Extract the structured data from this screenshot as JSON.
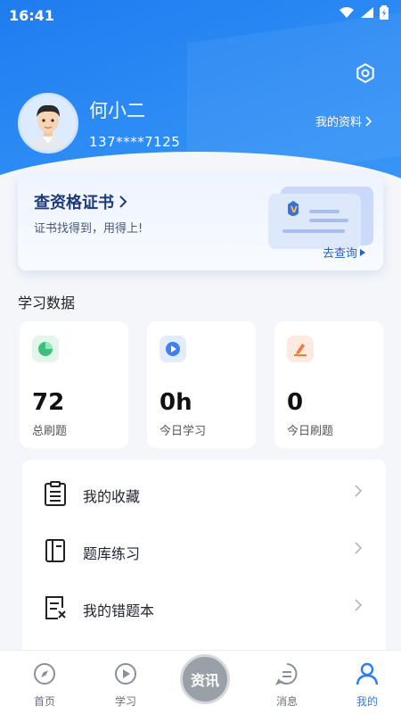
{
  "status_bar": {
    "time": "16:41"
  },
  "profile": {
    "name": "何小二",
    "phone": "137****7125",
    "profile_link": "我的资料"
  },
  "certificate": {
    "title": "查资格证书",
    "subtitle": "证书找得到，用得上!",
    "query_label": "去查询"
  },
  "stats": {
    "section_title": "学习数据",
    "items": [
      {
        "value": "72",
        "label": "总刷题",
        "icon": "pie-chart-icon",
        "color": "#3cc07a"
      },
      {
        "value": "0h",
        "label": "今日学习",
        "icon": "play-circle-icon",
        "color": "#3f7ff0"
      },
      {
        "value": "0",
        "label": "今日刷题",
        "icon": "edit-icon",
        "color": "#f07a3a"
      }
    ]
  },
  "menu": {
    "items": [
      {
        "label": "我的收藏",
        "icon": "clipboard-list-icon"
      },
      {
        "label": "题库练习",
        "icon": "notebook-icon"
      },
      {
        "label": "我的错题本",
        "icon": "wrong-note-icon"
      }
    ]
  },
  "tabbar": {
    "items": [
      {
        "label": "首页",
        "icon": "compass-icon"
      },
      {
        "label": "学习",
        "icon": "play-icon"
      },
      {
        "label": "消息",
        "icon": "message-icon"
      },
      {
        "label": "我的",
        "icon": "person-icon",
        "active": true
      }
    ],
    "center_label": "资讯"
  },
  "colors": {
    "primary": "#2f7df0",
    "header": "#1f7cf0"
  }
}
